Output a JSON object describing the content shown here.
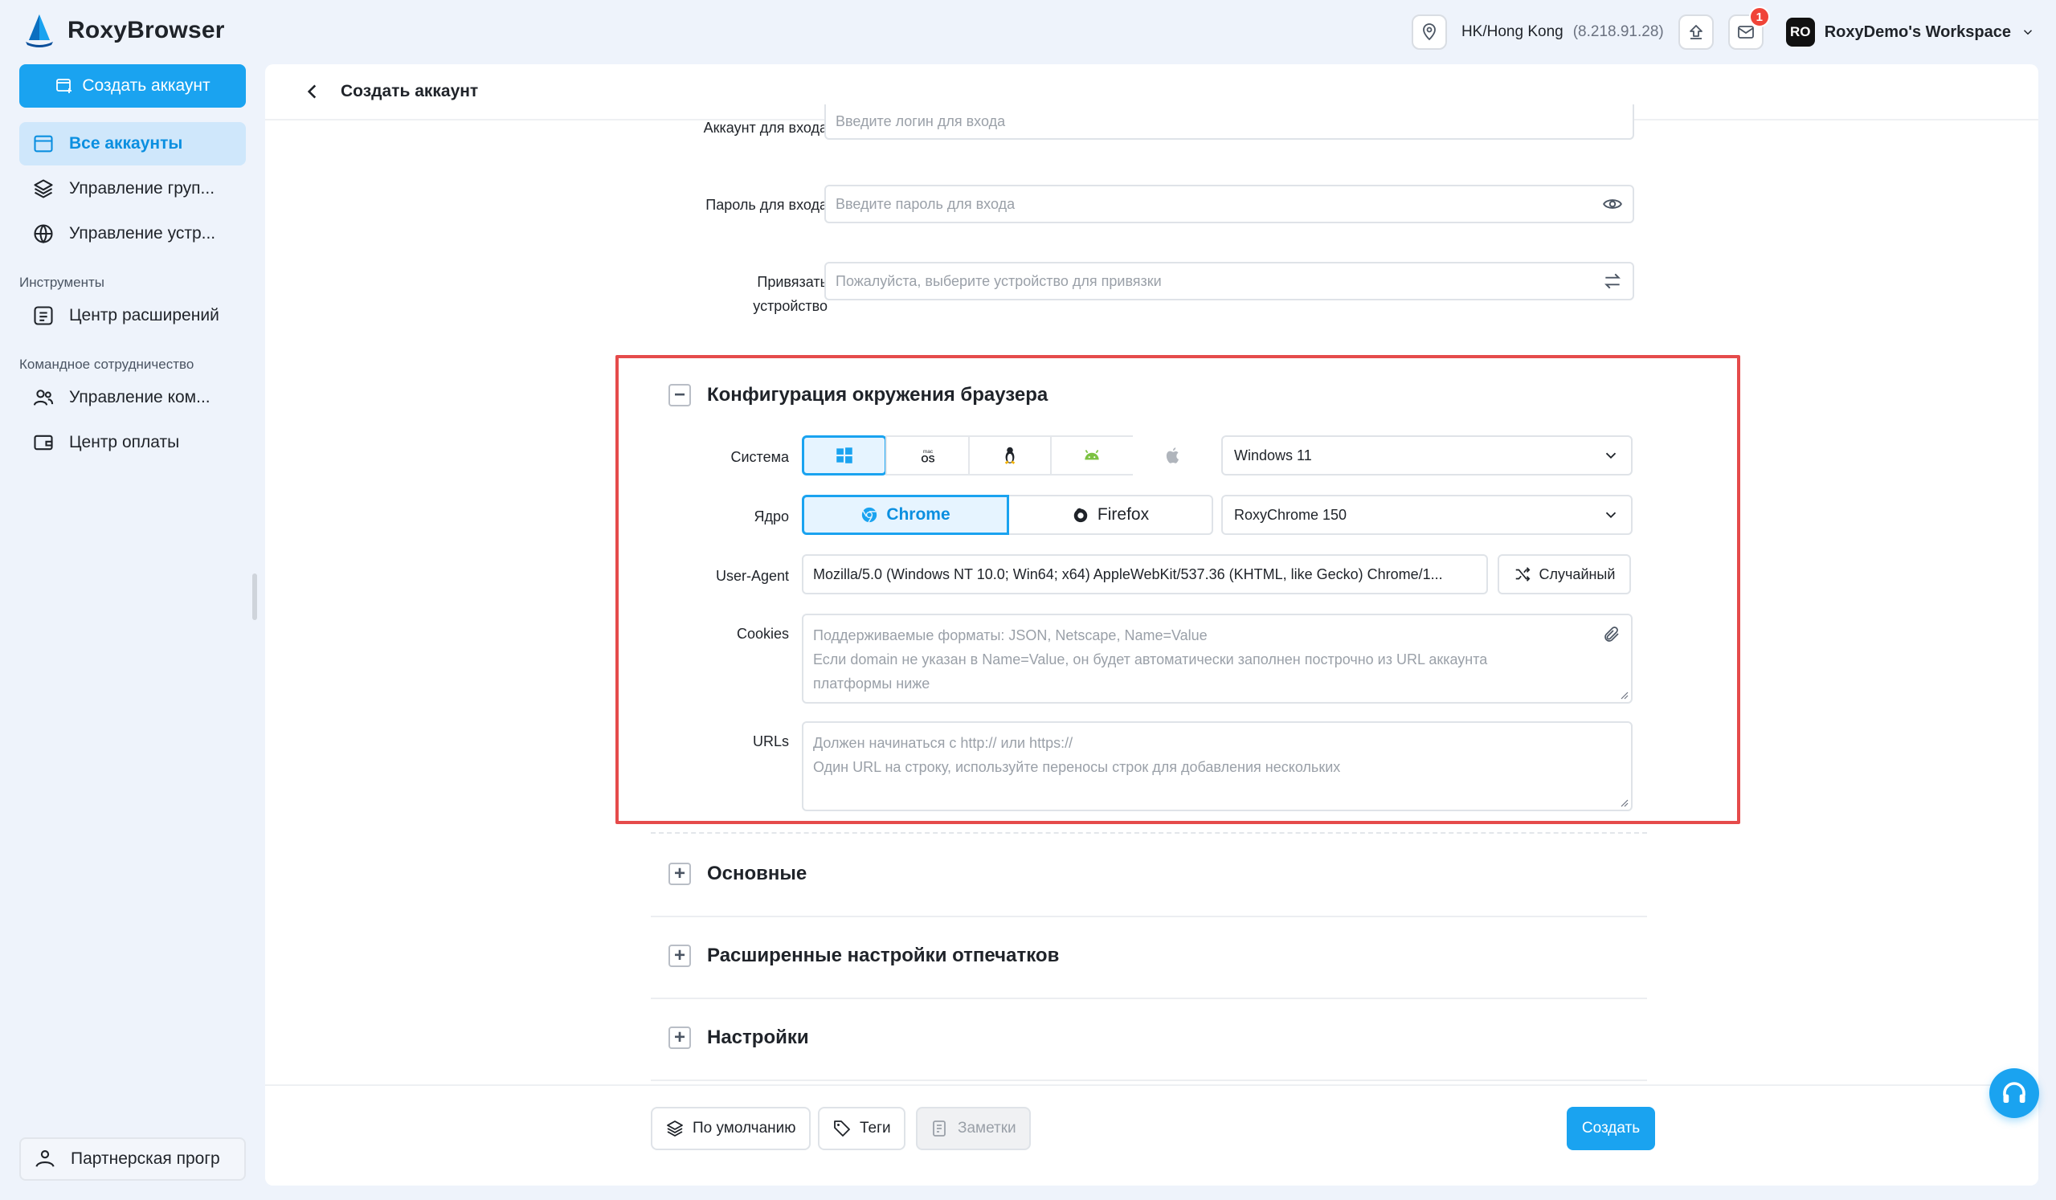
{
  "app": {
    "name": "RoxyBrowser",
    "brand_color": "#1aa3f0",
    "highlight_color": "#e54b4b"
  },
  "topbar": {
    "location": "HK/Hong Kong",
    "ip": "(8.218.91.28)",
    "mail_badge": "1",
    "workspace_avatar": "RO",
    "workspace_name": "RoxyDemo's Workspace"
  },
  "sidebar": {
    "create_button": "Создать аккаунт",
    "items": [
      {
        "label": "Все аккаунты",
        "icon": "accounts-icon"
      },
      {
        "label": "Управление груп...",
        "icon": "layers-icon"
      },
      {
        "label": "Управление устр...",
        "icon": "globe-icon"
      }
    ],
    "tools_section": "Инструменты",
    "tools_items": [
      {
        "label": "Центр расширений",
        "icon": "extensions-icon"
      }
    ],
    "team_section": "Командное сотрудничество",
    "team_items": [
      {
        "label": "Управление ком...",
        "icon": "team-icon"
      },
      {
        "label": "Центр оплаты",
        "icon": "wallet-icon"
      }
    ],
    "partner": "Партнерская прогр"
  },
  "page": {
    "title": "Создать аккаунт",
    "login_label": "Аккаунт для входа",
    "login_placeholder": "Введите логин для входа",
    "password_label": "Пароль для входа",
    "password_placeholder": "Введите пароль для входа",
    "bind_label": "Привязать устройство",
    "bind_placeholder": "Пожалуйста, выберите устройство для привязки"
  },
  "browser_config": {
    "title": "Конфигурация окружения браузера",
    "system_label": "Система",
    "os_options": [
      "windows-icon",
      "macos-icon",
      "linux-icon",
      "android-icon",
      "apple-icon"
    ],
    "macos_small": "mac",
    "macos_big": "OS",
    "os_version": "Windows 11",
    "kernel_label": "Ядро",
    "kernel_chrome": "Chrome",
    "kernel_firefox": "Firefox",
    "kernel_version": "RoxyChrome 150",
    "ua_label": "User-Agent",
    "ua_value": "Mozilla/5.0 (Windows NT 10.0; Win64; x64) AppleWebKit/537.36 (KHTML, like Gecko) Chrome/1...",
    "random_button": "Случайный",
    "cookies_label": "Cookies",
    "cookies_line1": "Поддерживаемые форматы: JSON, Netscape, Name=Value",
    "cookies_line2": "Если domain не указан в Name=Value, он будет автоматически заполнен построчно из URL аккаунта",
    "cookies_line3": "платформы ниже",
    "urls_label": "URLs",
    "urls_line1": "Должен начинаться с http:// или https://",
    "urls_line2": "Один URL на строку, используйте переносы строк для добавления нескольких"
  },
  "sections": {
    "basic": "Основные",
    "fingerprint": "Расширенные настройки отпечатков",
    "settings": "Настройки"
  },
  "footer": {
    "default_button": "По умолчанию",
    "tags_button": "Теги",
    "notes_button": "Заметки",
    "submit_button": "Создать"
  }
}
